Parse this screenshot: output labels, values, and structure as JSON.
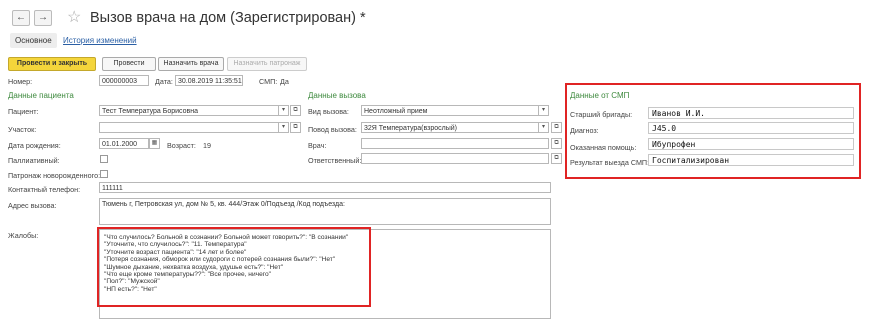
{
  "nav": {
    "back": "←",
    "forward": "→"
  },
  "title": "Вызов врача на дом (Зарегистрирован) *",
  "tabs": {
    "main": "Основное",
    "history": "История изменений"
  },
  "toolbar": {
    "post_close": "Провести и закрыть",
    "post": "Провести",
    "assign_doctor": "Назначить врача",
    "assign_patronage": "Назначить патронаж"
  },
  "header": {
    "number_label": "Номер:",
    "number_value": "000000003",
    "date_label": "Дата:",
    "date_value": "30.08.2019 11:35:51",
    "smp_label": "СМП:",
    "smp_value": "Да"
  },
  "patient_section": {
    "title": "Данные пациента",
    "patient_label": "Пациент:",
    "patient_value": "Тест Температура Борисовна",
    "area_label": "Участок:",
    "area_value": "",
    "dob_label": "Дата рождения:",
    "dob_value": "01.01.2000",
    "age_label": "Возраст:",
    "age_value": "19",
    "palliative_label": "Паллиативный:",
    "newborn_label": "Патронаж новорожденного:",
    "phone_label": "Контактный телефон:",
    "phone_value": "111111",
    "address_label": "Адрес вызова:",
    "address_value": "Тюмень г, Петровская ул, дом № 5, кв. 444/Этаж 0/Подъезд /Код подъезда:",
    "complaints_label": "Жалобы:",
    "complaints": [
      "\"Что случилось? Больной в сознании? Больной может говорить?\": \"В сознании\"",
      "\"Уточните, что случилось?\": \"11. Температура\"",
      "\"Уточните возраст пациента\": \"14 лет и более\"",
      "\"Потеря сознания, обморок или судороги с потерей сознания были?\": \"Нет\"",
      "\"Шумное дыхание, нехватка воздуха, удушье есть?\": \"Нет\"",
      "\"Что еще кроме температуры??\": \"Все прочее, ничего\"",
      "\"Пол?\": \"Мужской\"",
      "\"НП есть?\": \"Нет\""
    ]
  },
  "call_section": {
    "title": "Данные вызова",
    "type_label": "Вид вызова:",
    "type_value": "Неотложный прием",
    "reason_label": "Повод вызова:",
    "reason_value": "32Я Температура(взрослый)",
    "doctor_label": "Врач:",
    "doctor_value": "",
    "responsible_label": "Ответственный:",
    "responsible_value": ""
  },
  "smp_section": {
    "title": "Данные от СМП",
    "brigade_label": "Старший бригады:",
    "brigade_value": "Иванов И.И.",
    "diagnosis_label": "Диагноз:",
    "diagnosis_value": "J45.0",
    "help_label": "Оказанная помощь:",
    "help_value": "Ибупрофен",
    "result_label": "Результат выезда СМП:",
    "result_value": "Госпитализирован"
  },
  "icons": {
    "dropdown": "▾",
    "open": "⧉",
    "calendar": "▦",
    "star": "☆"
  },
  "colors": {
    "accent_green": "#3e8a3e",
    "highlight_red": "#e02424",
    "primary_button": "#f4d53b",
    "link": "#2a5fa5"
  }
}
